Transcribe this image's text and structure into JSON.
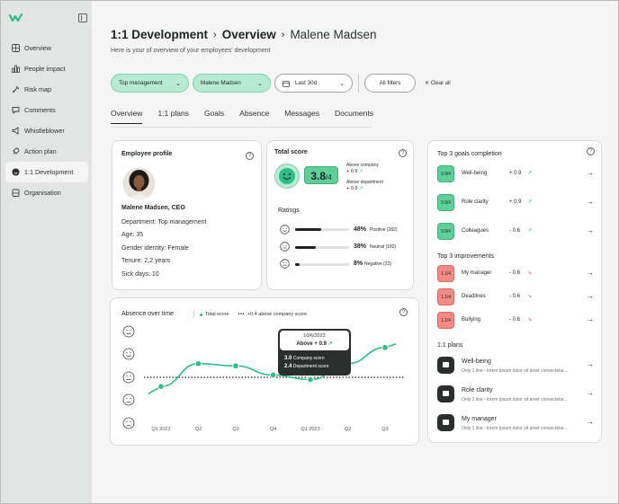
{
  "sidebar": {
    "items": [
      {
        "label": "Overview",
        "icon": "grid-icon"
      },
      {
        "label": "People impact",
        "icon": "bar-chart-icon"
      },
      {
        "label": "Risk map",
        "icon": "pin-icon"
      },
      {
        "label": "Comments",
        "icon": "chat-icon"
      },
      {
        "label": "Whistleblower",
        "icon": "megaphone-icon"
      },
      {
        "label": "Action plan",
        "icon": "rocket-icon"
      },
      {
        "label": "1:1 Development",
        "icon": "smile-icon",
        "active": true
      },
      {
        "label": "Organisation",
        "icon": "building-icon"
      }
    ]
  },
  "header": {
    "crumb1": "1:1 Development",
    "crumb2": "Overview",
    "person": "Malene Madsen",
    "subtitle": "Here is your of overview of your employees' development"
  },
  "filters": {
    "department": "Top management",
    "employee": "Malene Madsen",
    "period": "Last 30d",
    "all_filters": "All filters",
    "clear_all": "Clear all"
  },
  "tabs": [
    "Overview",
    "1:1 plans",
    "Goals",
    "Absence",
    "Messages",
    "Documents"
  ],
  "profile": {
    "title": "Employee profile",
    "name": "Malene Madsen, CEO",
    "department": "Department: Top management",
    "age": "Age: 35",
    "gender": "Gender identity: Female",
    "tenure": "Tenure: 2,2 years",
    "sick_days": "Sick days: 10"
  },
  "total_score": {
    "title": "Total score",
    "score": "3.8",
    "out_of": "/4",
    "above_company_label": "Above company",
    "above_company_value": "+ 0.9",
    "above_department_label": "Above department",
    "above_department_value": "+ 0.9",
    "ratings_title": "Ratings",
    "ratings": [
      {
        "pct_label": "48%",
        "label": "Positive (282)",
        "value": 0.48
      },
      {
        "pct_label": "38%",
        "label": "Neutral (182)",
        "value": 0.38
      },
      {
        "pct_label": "8%",
        "label": "Negative (22)",
        "value": 0.08
      }
    ]
  },
  "goals": {
    "title": "Top 3 goals completion",
    "items": [
      {
        "badge": "3.9/4",
        "label": "Well-being",
        "value": "+ 0.9"
      },
      {
        "badge": "3.9/4",
        "label": "Role clarity",
        "value": "+ 0.9"
      },
      {
        "badge": "3.9/4",
        "label": "Colleagues",
        "value": "- 0.6"
      }
    ],
    "improvements_title": "Top 3 improvements",
    "improvements": [
      {
        "badge": "1.1/4",
        "label": "My manager",
        "value": "- 0.6"
      },
      {
        "badge": "1.1/4",
        "label": "Deadlines",
        "value": "- 0.6"
      },
      {
        "badge": "1.1/4",
        "label": "Bullying",
        "value": "- 0.6"
      }
    ],
    "plans_title": "1:1 plans",
    "plans": [
      {
        "title": "Well-being",
        "desc": "Only 1 line - lorem ipsum dolor sit amet consectetur..."
      },
      {
        "title": "Role clarity",
        "desc": "Only 1 line - lorem ipsum dolor sit amet consectetur..."
      },
      {
        "title": "My manager",
        "desc": "Only 1 line - lorem ipsum dolor sit amet consectetur..."
      }
    ]
  },
  "absence": {
    "title": "Absence over time",
    "legend_total": "Total score",
    "legend_company": "+0.4 above company score",
    "tooltip": {
      "date": "10/6/2023",
      "headline": "Above + 0.9",
      "company_value": "3.0",
      "company_label": "Company score",
      "department_value": "2.4",
      "department_label": "Department score"
    }
  },
  "colors": {
    "accent": "#2bbf86",
    "accent_light": "#b6ead3",
    "negative": "#f28b84",
    "dark": "#1d2421"
  },
  "chart_data": {
    "type": "line",
    "categories": [
      "Q1 2022",
      "Q2",
      "Q3",
      "Q4",
      "Q1 2023",
      "Q2",
      "Q3"
    ],
    "y_levels": 5,
    "series": [
      {
        "name": "Total score",
        "values": [
          1.6,
          2.6,
          2.5,
          2.1,
          1.9,
          2.6,
          3.3
        ]
      },
      {
        "values": [
          2.0,
          2.0,
          2.0,
          2.0,
          2.0,
          2.0,
          2.0
        ]
      }
    ],
    "xlabel": "",
    "ylabel": ""
  }
}
